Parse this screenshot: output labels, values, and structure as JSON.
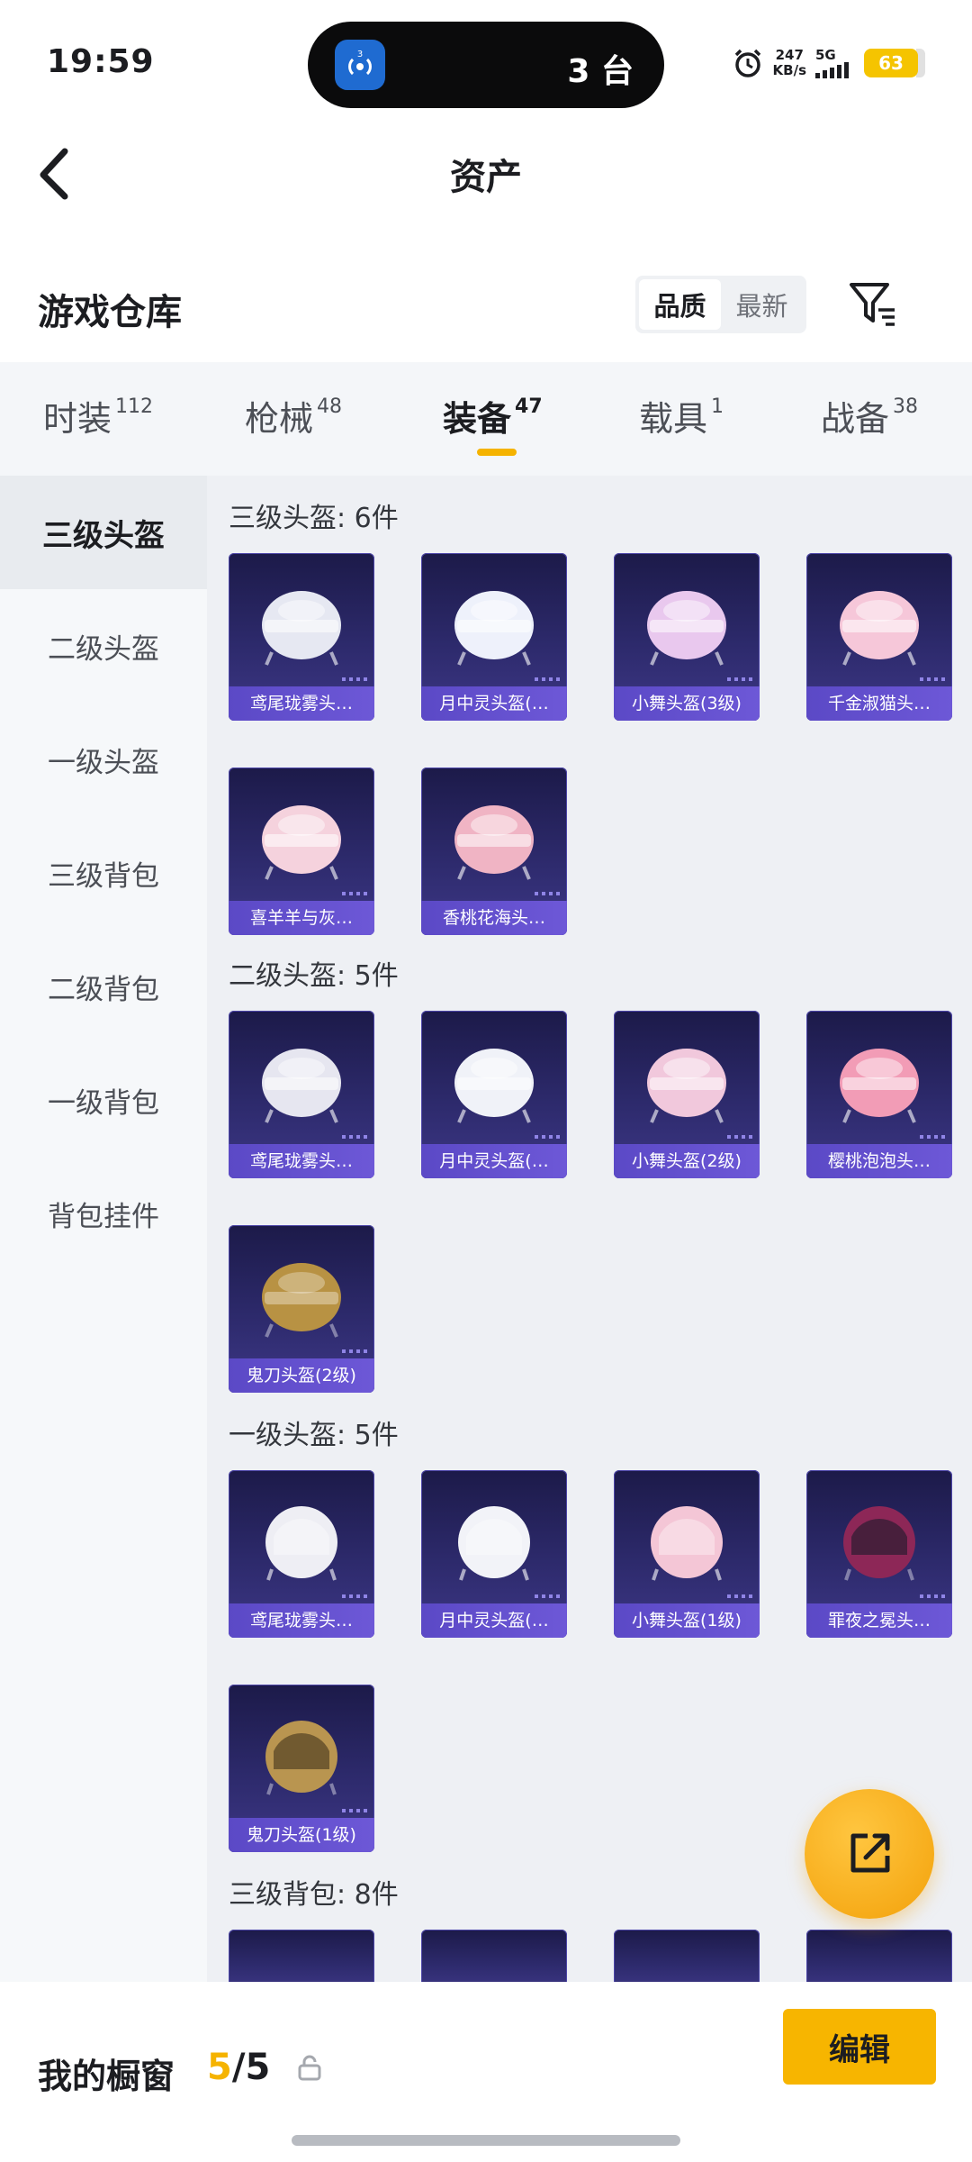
{
  "status_bar": {
    "time": "19:59",
    "island_text": "3 台",
    "island_badge": "3",
    "net_speed_value": "247",
    "net_speed_unit": "KB/s",
    "network": "5G",
    "battery": "63"
  },
  "header": {
    "title": "资产",
    "back_icon": "chevron-left-icon"
  },
  "section": {
    "title": "游戏仓库",
    "sort_options": [
      "品质",
      "最新"
    ],
    "sort_selected": "品质",
    "filter_icon": "filter-icon"
  },
  "tabs": [
    {
      "label": "时装",
      "count": "112"
    },
    {
      "label": "枪械",
      "count": "48"
    },
    {
      "label": "装备",
      "count": "47"
    },
    {
      "label": "载具",
      "count": "1"
    },
    {
      "label": "战备",
      "count": "38"
    }
  ],
  "active_tab": "装备",
  "sidebar": [
    {
      "label": "三级头盔"
    },
    {
      "label": "二级头盔"
    },
    {
      "label": "一级头盔"
    },
    {
      "label": "三级背包"
    },
    {
      "label": "二级背包"
    },
    {
      "label": "一级背包"
    },
    {
      "label": "背包挂件"
    }
  ],
  "groups": [
    {
      "title": "三级头盔: 6件",
      "items": [
        {
          "name": "鸢尾珑雾头…",
          "color": "#e6e8f2"
        },
        {
          "name": "月中灵头盔(…",
          "color": "#eef1fb"
        },
        {
          "name": "小舞头盔(3级)",
          "color": "#e9c8ee"
        },
        {
          "name": "千金淑猫头…",
          "color": "#f6c7d9"
        },
        {
          "name": "喜羊羊与灰…",
          "color": "#f5d2dd"
        },
        {
          "name": "香桃花海头…",
          "color": "#f0b4c4"
        }
      ]
    },
    {
      "title": "二级头盔: 5件",
      "items": [
        {
          "name": "鸢尾珑雾头…",
          "color": "#e6e6f0"
        },
        {
          "name": "月中灵头盔(…",
          "color": "#f0f2f8"
        },
        {
          "name": "小舞头盔(2级)",
          "color": "#f1c8dc"
        },
        {
          "name": "樱桃泡泡头…",
          "color": "#f29cb6"
        },
        {
          "name": "鬼刀头盔(2级)",
          "color": "#b89243"
        }
      ]
    },
    {
      "title": "一级头盔: 5件",
      "items": [
        {
          "name": "鸢尾珑雾头…",
          "color": "#eeeef4"
        },
        {
          "name": "月中灵头盔(…",
          "color": "#f2f3f8"
        },
        {
          "name": "小舞头盔(1级)",
          "color": "#f4c6d6"
        },
        {
          "name": "罪夜之冕头…",
          "color": "#8d2757"
        },
        {
          "name": "鬼刀头盔(1级)",
          "color": "#b99550"
        }
      ]
    },
    {
      "title": "三级背包: 8件",
      "items": []
    }
  ],
  "fab_icon": "share-out-icon",
  "bottom_bar": {
    "title": "我的橱窗",
    "count_current": "5",
    "count_separator": "/",
    "count_total": "5",
    "lock_icon": "lock-icon",
    "edit_label": "编辑"
  }
}
